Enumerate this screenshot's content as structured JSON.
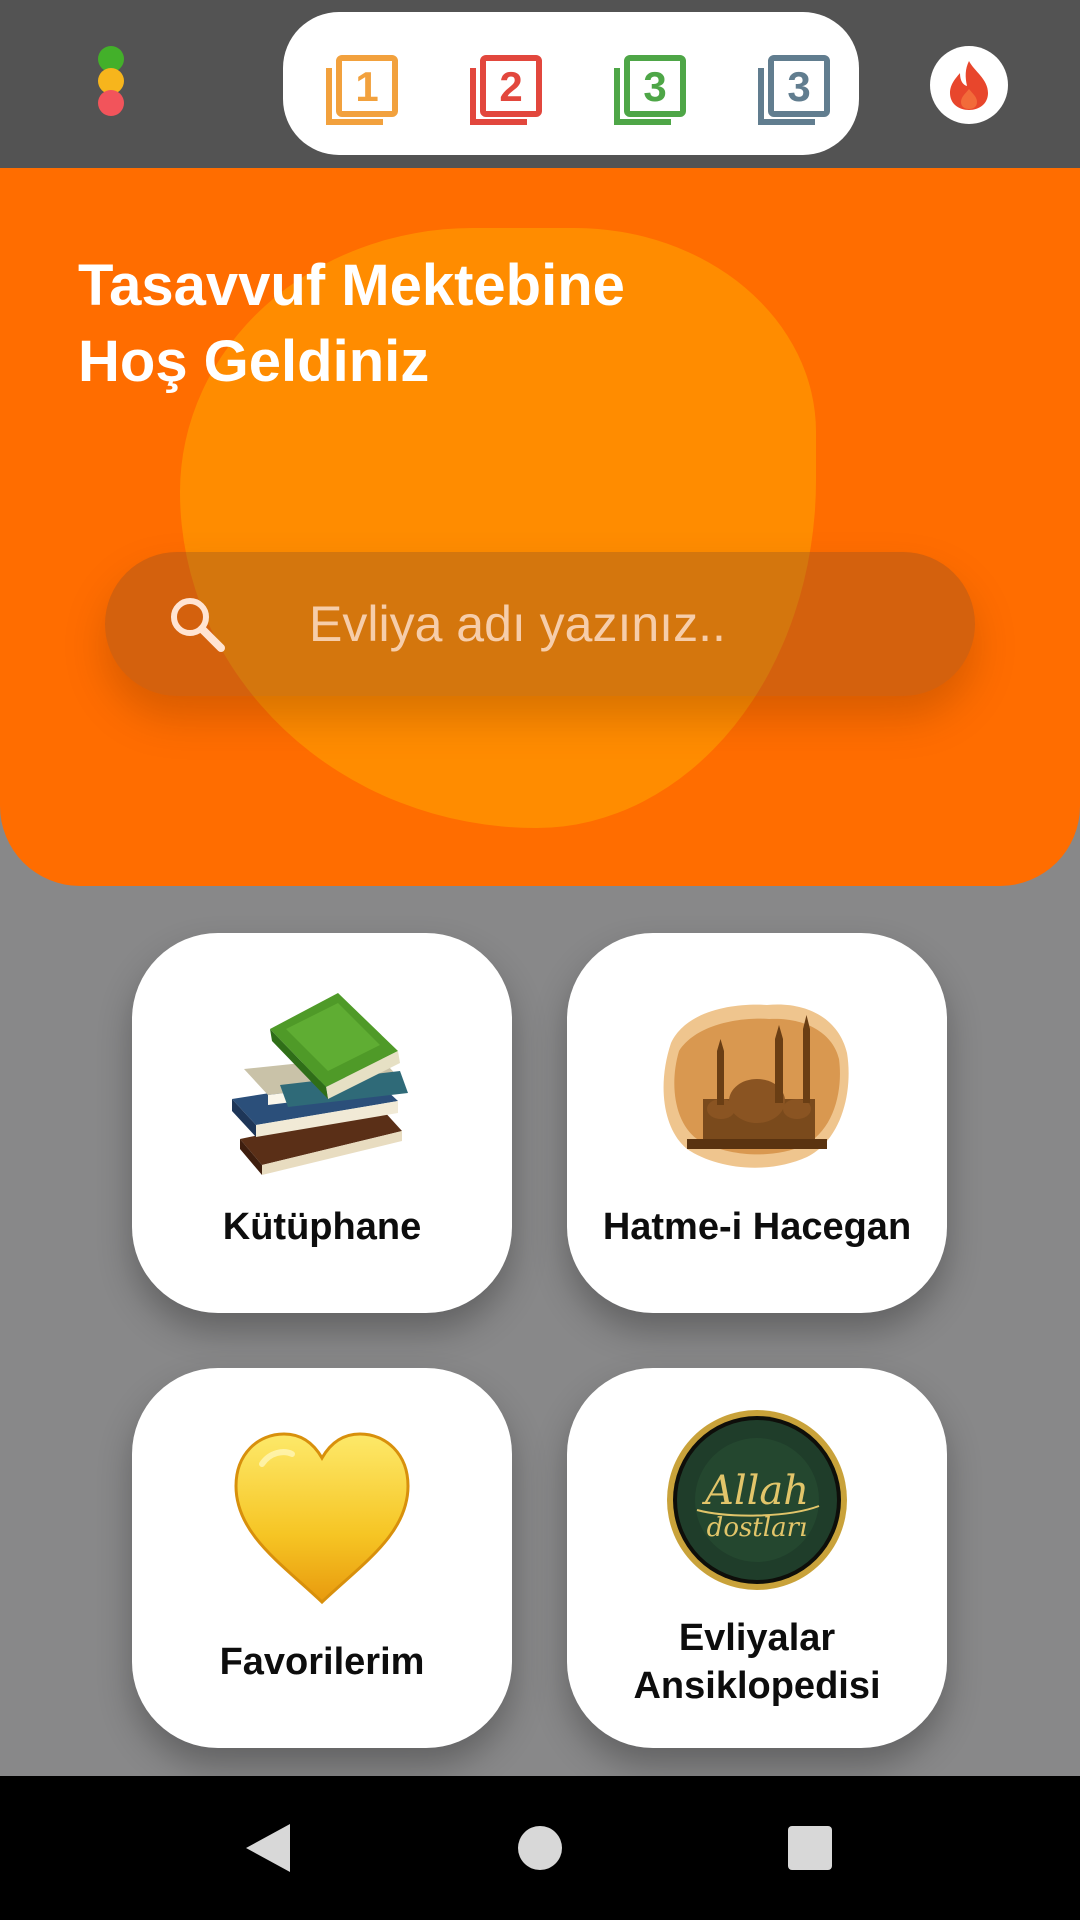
{
  "top_bar": {
    "menu_dots_colors": [
      "#43b02a",
      "#f7b51c",
      "#f2545b"
    ],
    "tabs": [
      {
        "number": "1",
        "color": "#f2a13d",
        "icon": "book-1-icon"
      },
      {
        "number": "2",
        "color": "#e2473d",
        "icon": "book-2-icon"
      },
      {
        "number": "3",
        "color": "#4ea647",
        "icon": "book-3-icon"
      },
      {
        "number": "3",
        "color": "#617d8f",
        "icon": "book-3-alt-icon"
      }
    ],
    "flame_icon_color": "#e8462c"
  },
  "hero": {
    "title_line1": "Tasavvuf Mektebine",
    "title_line2": "Hoş Geldiniz",
    "search_placeholder": "Evliya adı yazınız..",
    "background_color": "#ff6d00",
    "blob_color": "#ff8f00"
  },
  "grid": [
    {
      "label": "Kütüphane",
      "icon": "books-stack-icon"
    },
    {
      "label": "Hatme-i Hacegan",
      "icon": "mosque-painting-icon"
    },
    {
      "label": "Favorilerim",
      "icon": "yellow-heart-icon"
    },
    {
      "label_line1": "Evliyalar",
      "label_line2": "Ansiklopedisi",
      "icon": "allah-dostlari-emblem-icon"
    }
  ],
  "emblem": {
    "line1": "Allah",
    "line2": "dostları"
  },
  "nav_bar": {
    "buttons": [
      "back-icon",
      "home-icon",
      "recents-icon"
    ]
  }
}
